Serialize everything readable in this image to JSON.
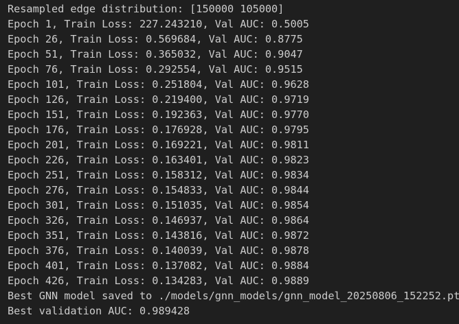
{
  "terminal": {
    "lines": [
      "Resampled edge distribution: [150000 105000]",
      "Epoch 1, Train Loss: 227.243210, Val AUC: 0.5005",
      "Epoch 26, Train Loss: 0.569684, Val AUC: 0.8775",
      "Epoch 51, Train Loss: 0.365032, Val AUC: 0.9047",
      "Epoch 76, Train Loss: 0.292554, Val AUC: 0.9515",
      "Epoch 101, Train Loss: 0.251804, Val AUC: 0.9628",
      "Epoch 126, Train Loss: 0.219400, Val AUC: 0.9719",
      "Epoch 151, Train Loss: 0.192363, Val AUC: 0.9770",
      "Epoch 176, Train Loss: 0.176928, Val AUC: 0.9795",
      "Epoch 201, Train Loss: 0.169221, Val AUC: 0.9811",
      "Epoch 226, Train Loss: 0.163401, Val AUC: 0.9823",
      "Epoch 251, Train Loss: 0.158312, Val AUC: 0.9834",
      "Epoch 276, Train Loss: 0.154833, Val AUC: 0.9844",
      "Epoch 301, Train Loss: 0.151035, Val AUC: 0.9854",
      "Epoch 326, Train Loss: 0.146937, Val AUC: 0.9864",
      "Epoch 351, Train Loss: 0.143816, Val AUC: 0.9872",
      "Epoch 376, Train Loss: 0.140039, Val AUC: 0.9878",
      "Epoch 401, Train Loss: 0.137082, Val AUC: 0.9884",
      "Epoch 426, Train Loss: 0.134283, Val AUC: 0.9889",
      "Best GNN model saved to ./models/gnn_models/gnn_model_20250806_152252.pt",
      "Best validation AUC: 0.989428"
    ]
  },
  "colors": {
    "background": "#1f1f1f",
    "text": "#cccccc"
  }
}
